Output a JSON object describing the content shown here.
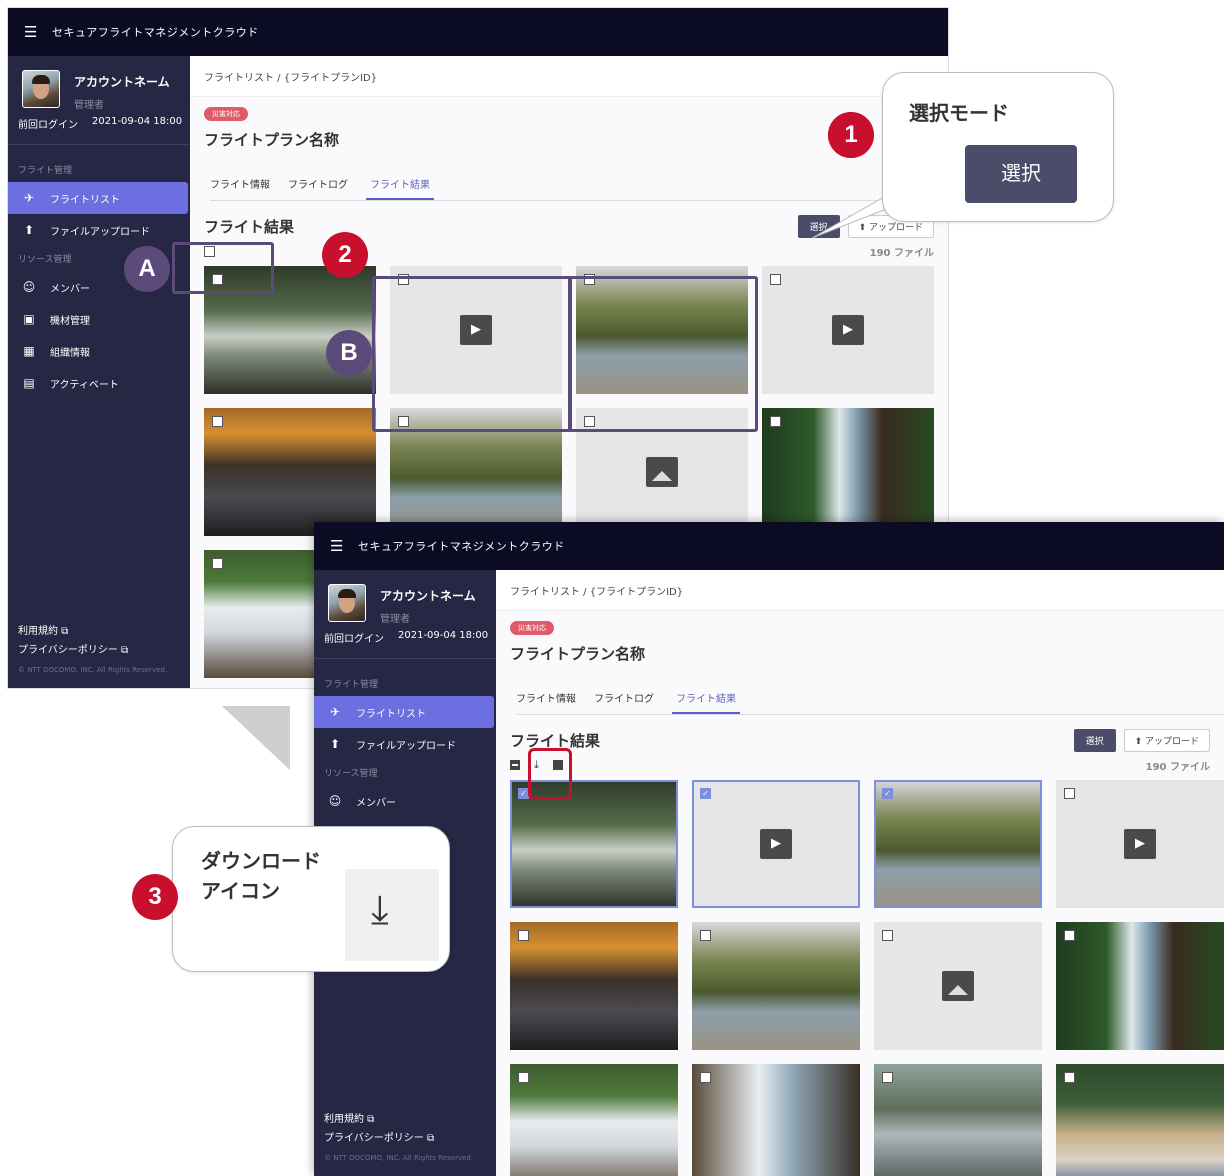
{
  "app": {
    "title": "セキュアフライトマネジメントクラウド"
  },
  "account": {
    "name": "アカウントネーム",
    "role": "管理者",
    "last_login_label": "前回ログイン",
    "last_login_value": "2021-09-04 18:00"
  },
  "sidebar": {
    "section_flight": "フライト管理",
    "section_resource": "リソース管理",
    "items": [
      {
        "label": "フライトリスト",
        "icon": "airplane-icon"
      },
      {
        "label": "ファイルアップロード",
        "icon": "upload-icon"
      },
      {
        "label": "メンバー",
        "icon": "people-icon"
      },
      {
        "label": "機材管理",
        "icon": "clipboard-icon"
      },
      {
        "label": "組織情報",
        "icon": "building-icon"
      },
      {
        "label": "アクティベート",
        "icon": "sim-icon"
      }
    ],
    "terms": "利用規約 ⧉",
    "privacy": "プライバシーポリシー ⧉",
    "copyright": "© NTT DOCOMO, INC. All Rights Reserved."
  },
  "main": {
    "breadcrumb": "フライトリスト / {フライトプランID}",
    "tag": "災害対応",
    "plan_title": "フライトプラン名称",
    "tabs": [
      "フライト情報",
      "フライトログ",
      "フライト結果"
    ],
    "section_title": "フライト結果",
    "select_button": "選択",
    "upload_button": "⬆ アップロード",
    "file_count": "190 ファイル"
  },
  "annotations": {
    "callout1_title": "選択モード",
    "callout1_button": "選択",
    "callout3_title_line1": "ダウンロード",
    "callout3_title_line2": "アイコン",
    "badge1": "1",
    "badge2": "2",
    "badge3": "3",
    "badge_a": "A",
    "badge_b": "B"
  },
  "colors": {
    "topbar": "#0b0c24",
    "sidebar": "#252744",
    "active_nav": "#6c6fe0",
    "accent_red": "#c8102e",
    "accent_purple": "#5c4a7a",
    "selected_outline": "#7c8fdc"
  }
}
